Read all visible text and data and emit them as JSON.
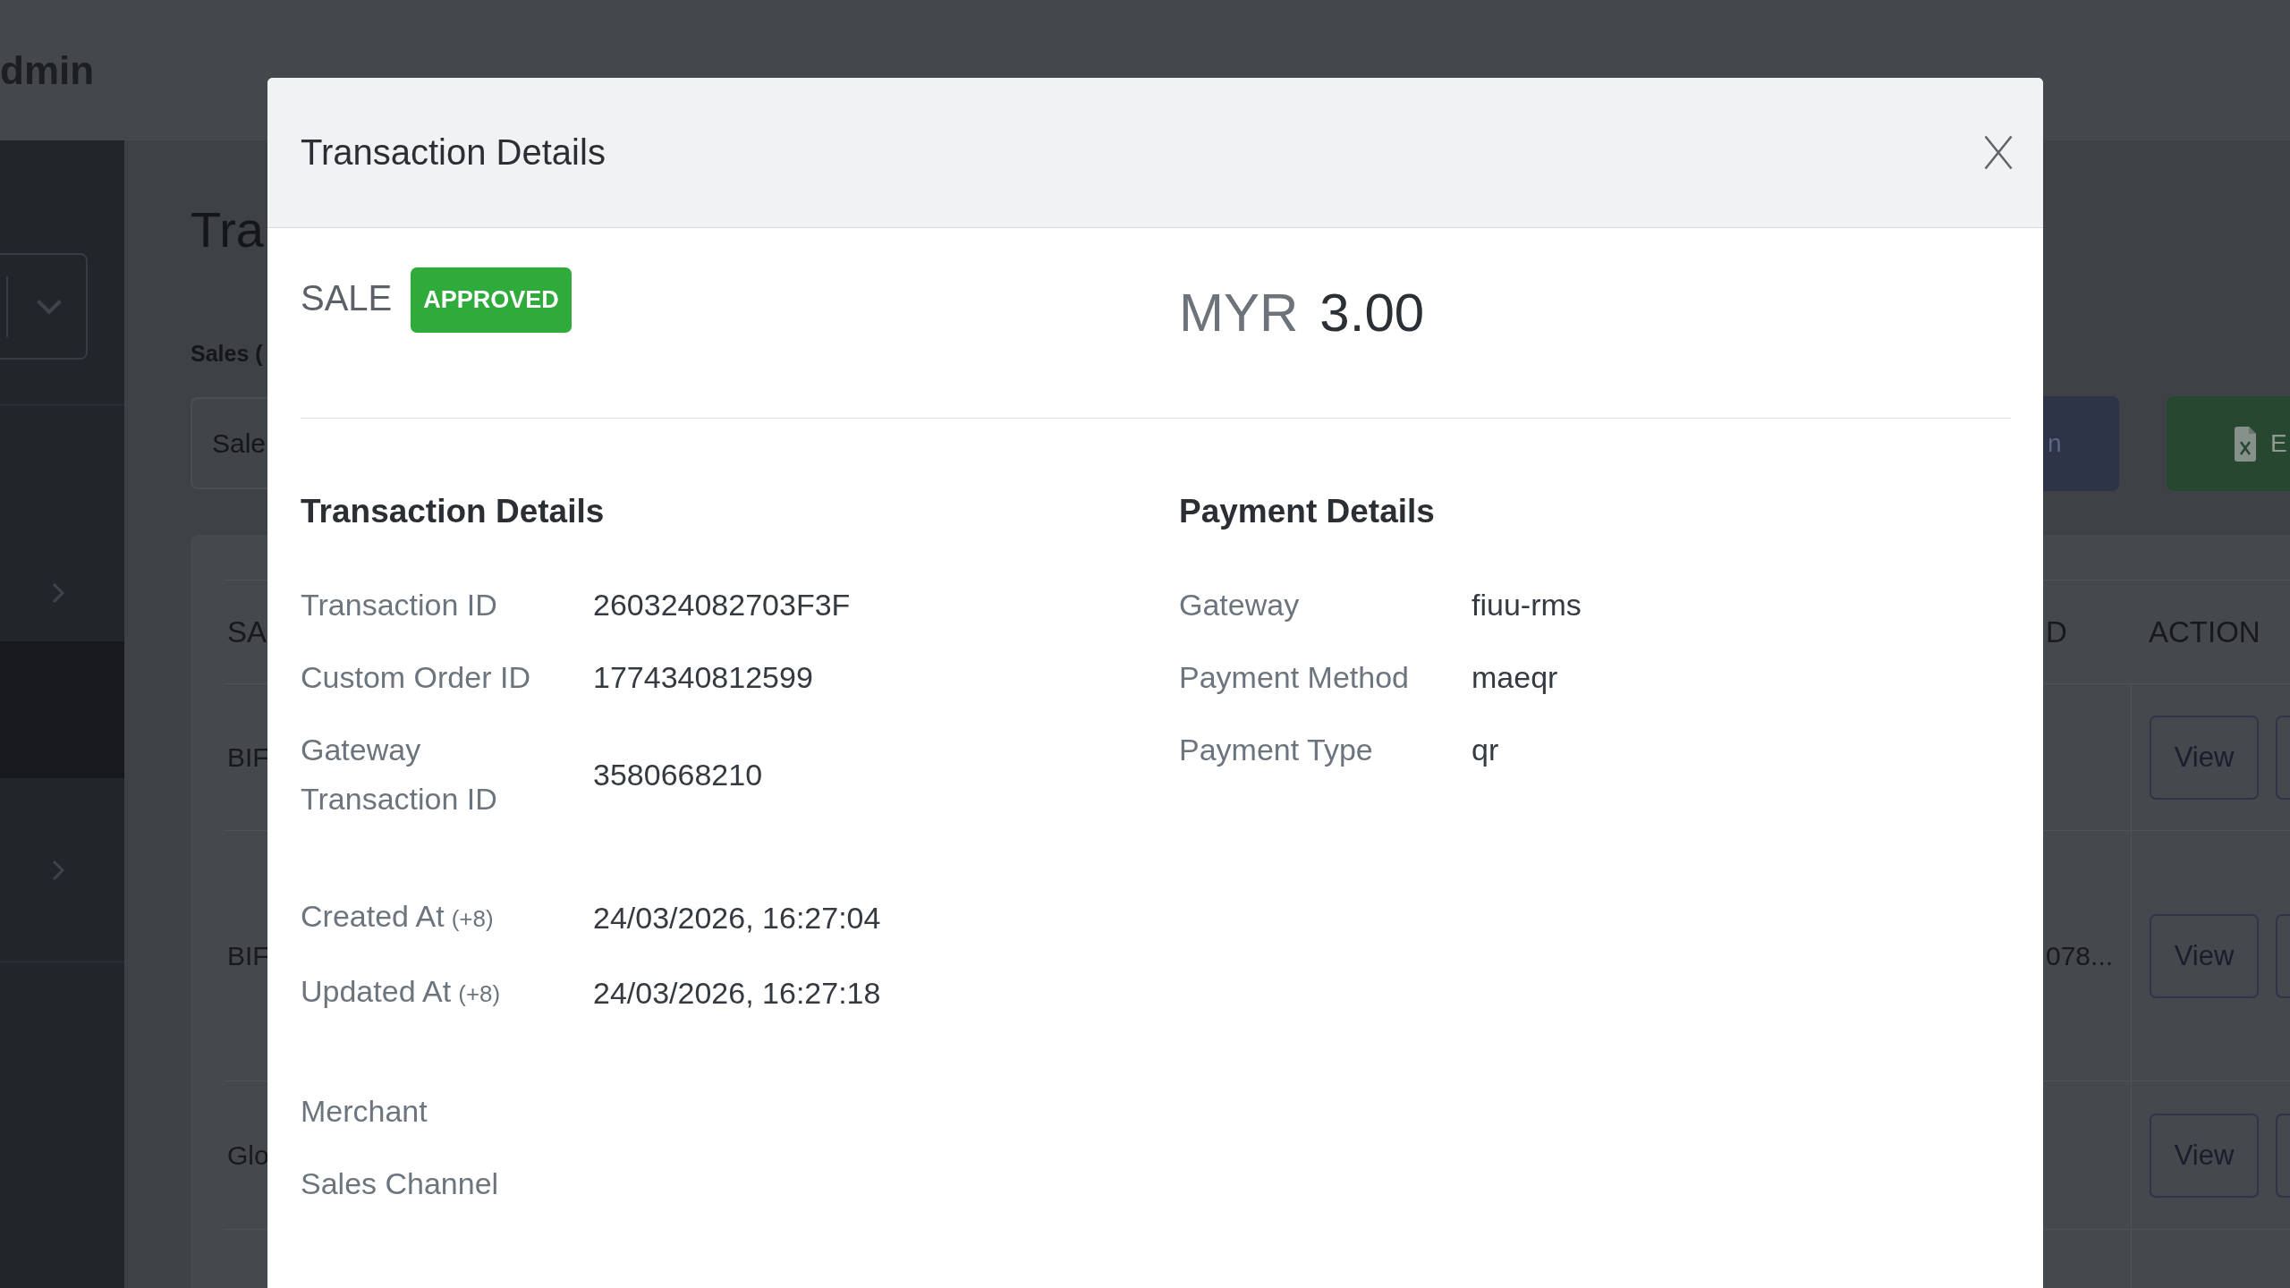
{
  "app_bar": {
    "title": "dmin"
  },
  "sidebar": {
    "sections": [
      {
        "items": [
          {
            "expandable": true,
            "selected": false
          },
          {
            "expandable": false,
            "selected": true
          }
        ]
      },
      {
        "items": [
          {
            "expandable": true,
            "selected": false
          }
        ]
      }
    ]
  },
  "page": {
    "title": "Tra",
    "filter": {
      "label": "Sales (",
      "placeholder": "Sale"
    },
    "buttons": [
      {
        "kind": "primary",
        "label": "n"
      },
      {
        "kind": "export",
        "label": "E"
      }
    ],
    "table": {
      "columns": [
        "SA",
        "D",
        "ACTION"
      ],
      "rows": [
        {
          "column_1": "BIF",
          "action": "View"
        },
        {
          "column_1": "BIF",
          "column_2": "078...",
          "action": "View"
        },
        {
          "column_1": "Glo",
          "action": "View"
        }
      ]
    }
  },
  "modal": {
    "title": "Transaction Details",
    "summary": {
      "type": "SALE",
      "status": {
        "label": "APPROVED",
        "kind": "success"
      },
      "currency": "MYR",
      "amount": "3.00"
    },
    "sections": [
      {
        "title": "Transaction Details",
        "groups": [
          {
            "rows": [
              {
                "label": "Transaction ID",
                "value": "260324082703F3F"
              },
              {
                "label": "Custom Order ID",
                "value": "1774340812599"
              },
              {
                "label": "Gateway Transaction ID",
                "value": "3580668210"
              }
            ]
          },
          {
            "rows": [
              {
                "label": "Created At",
                "note": "(+8)",
                "value": "24/03/2026, 16:27:04"
              },
              {
                "label": "Updated At",
                "note": "(+8)",
                "value": "24/03/2026, 16:27:18"
              }
            ]
          },
          {
            "rows": [
              {
                "label": "Merchant"
              },
              {
                "label": "Sales Channel"
              }
            ]
          }
        ]
      },
      {
        "title": "Payment Details",
        "groups": [
          {
            "rows": [
              {
                "label": "Gateway",
                "value": "fiuu-rms"
              },
              {
                "label": "Payment Method",
                "value": "maeqr"
              },
              {
                "label": "Payment Type",
                "value": "qr"
              }
            ]
          }
        ]
      }
    ]
  }
}
